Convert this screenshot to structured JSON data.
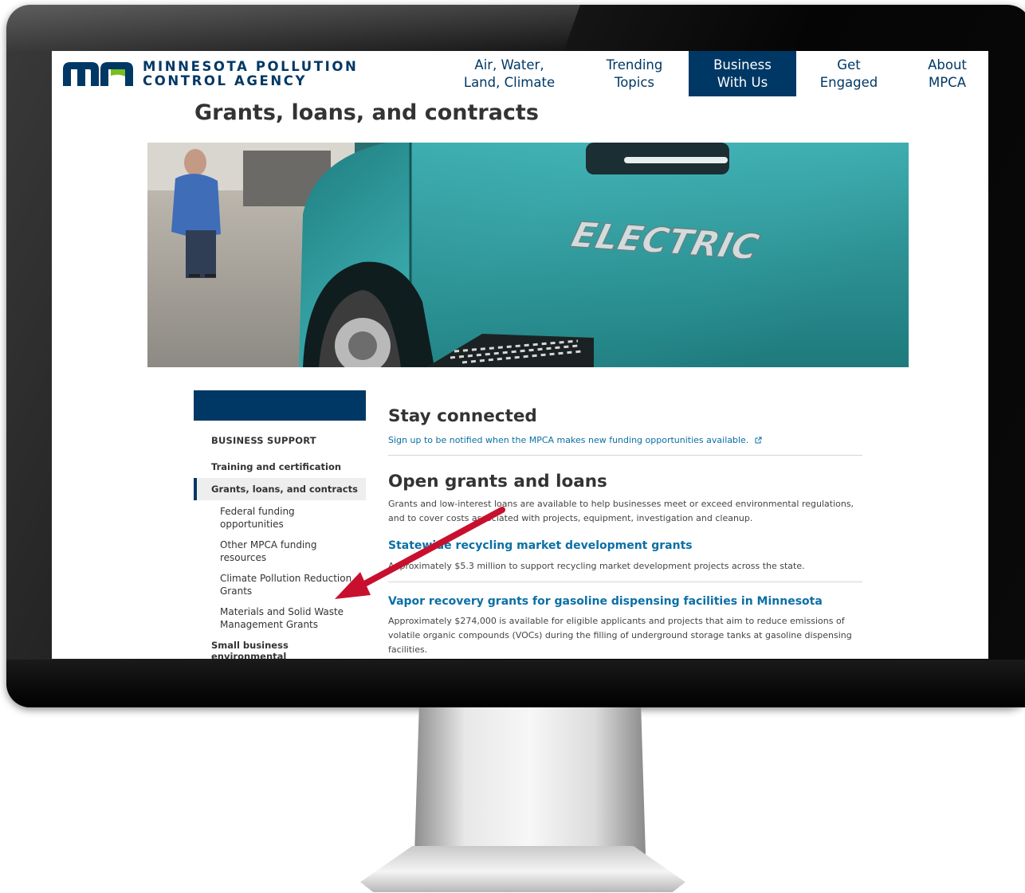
{
  "header": {
    "agency_line1": "MINNESOTA POLLUTION",
    "agency_line2": "CONTROL AGENCY",
    "nav": [
      {
        "label": "Air, Water,\nLand, Climate"
      },
      {
        "label": "Trending\nTopics"
      },
      {
        "label": "Business\nWith Us",
        "active": true
      },
      {
        "label": "Get\nEngaged"
      },
      {
        "label": "About\nMPCA"
      }
    ]
  },
  "page": {
    "title": "Grants, loans, and contracts",
    "hero_text": "ELECTRIC"
  },
  "sidebar": {
    "section": "BUSINESS SUPPORT",
    "items": [
      {
        "label": "Training and certification",
        "level": 1
      },
      {
        "label": "Grants, loans, and contracts",
        "level": 1,
        "active": true
      },
      {
        "label": "Federal funding opportunities",
        "level": 2
      },
      {
        "label": "Other MPCA funding resources",
        "level": 2
      },
      {
        "label": "Climate Pollution Reduction Grants",
        "level": 2
      },
      {
        "label": "Materials and Solid Waste Management Grants",
        "level": 2
      },
      {
        "label": "Small business environmental",
        "level": 1
      }
    ]
  },
  "main": {
    "stay_title": "Stay connected",
    "signup_link": "Sign up to be notified when the MPCA makes new funding opportunities available.",
    "open_title": "Open grants and loans",
    "open_intro": "Grants and low-interest loans are available to help businesses meet or exceed environmental regulations, and to cover costs associated with projects, equipment, investigation and cleanup.",
    "grants": [
      {
        "title": "Statewide recycling market development grants",
        "desc": "Approximately $5.3 million to support recycling market development projects across the state."
      },
      {
        "title": "Vapor recovery grants for gasoline dispensing facilities in Minnesota",
        "desc": "Approximately $274,000 is available for eligible applicants and projects that aim to reduce emissions of volatile organic compounds (VOCs) during the filling of underground storage tanks at gasoline dispensing facilities."
      }
    ]
  },
  "colors": {
    "brand_navy": "#003865",
    "brand_green": "#78be20",
    "link_blue": "#0b6fa6",
    "annotation_red": "#c8102e"
  },
  "icons": {
    "logo": "mn-logo-icon",
    "external": "external-link-icon",
    "arrow": "annotation-arrow"
  }
}
